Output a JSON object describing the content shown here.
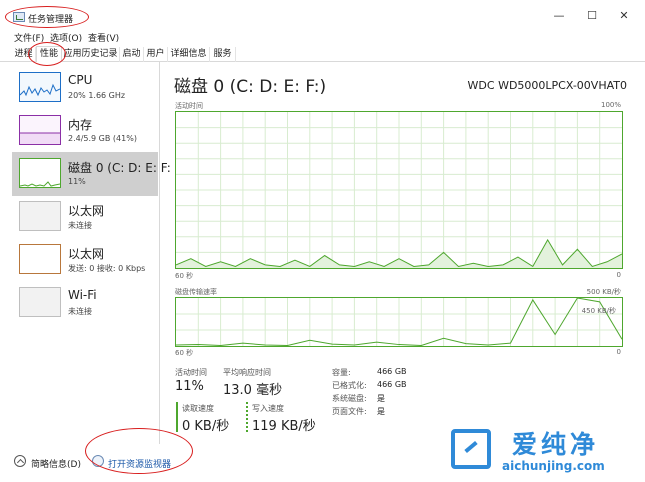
{
  "window": {
    "title": "任务管理器",
    "controls": {
      "minimize": "—",
      "maximize": "☐",
      "close": "✕"
    }
  },
  "menu": {
    "file": "文件(F)",
    "options": "选项(O)",
    "view": "查看(V)"
  },
  "tabs": [
    {
      "label": "进程"
    },
    {
      "label": "性能"
    },
    {
      "label": "应用历史记录"
    },
    {
      "label": "启动"
    },
    {
      "label": "用户"
    },
    {
      "label": "详细信息"
    },
    {
      "label": "服务"
    }
  ],
  "sidebar": {
    "items": [
      {
        "name": "CPU",
        "sub": "20% 1.66 GHz",
        "color": "#1e6fc7"
      },
      {
        "name": "内存",
        "sub": "2.4/5.9 GB (41%)",
        "color": "#8b2fa6"
      },
      {
        "name": "磁盘 0 (C: D: E: F:",
        "sub": "11%",
        "color": "#4ea72e"
      },
      {
        "name": "以太网",
        "sub": "未连接",
        "color": "#bfbfbf"
      },
      {
        "name": "以太网",
        "sub": "发送: 0 接收: 0 Kbps",
        "color": "#b8773c"
      },
      {
        "name": "Wi-Fi",
        "sub": "未连接",
        "color": "#bfbfbf"
      }
    ]
  },
  "disk": {
    "title": "磁盘 0 (C: D: E: F:)",
    "model": "WDC WD5000LPCX-00VHAT0",
    "active_time_label": "活动时间",
    "active_max": "100%",
    "active_x_left": "60 秒",
    "active_x_right": "0",
    "transfer_label": "磁盘传输速率",
    "transfer_max": "500 KB/秒",
    "transfer_mark": "450 KB/秒",
    "transfer_x_left": "60 秒",
    "transfer_x_right": "0",
    "stats": {
      "active_label": "活动时间",
      "active_value": "11%",
      "response_label": "平均响应时间",
      "response_value": "13.0 毫秒",
      "read_label": "读取速度",
      "read_value": "0 KB/秒",
      "write_label": "写入速度",
      "write_value": "119 KB/秒"
    },
    "details": [
      {
        "label": "容量:",
        "value": "466 GB"
      },
      {
        "label": "已格式化:",
        "value": "466 GB"
      },
      {
        "label": "系统磁盘:",
        "value": "是"
      },
      {
        "label": "页面文件:",
        "value": "是"
      }
    ]
  },
  "chart_data": [
    {
      "type": "area",
      "title": "活动时间",
      "x": [
        60,
        58,
        56,
        54,
        52,
        50,
        48,
        46,
        44,
        42,
        40,
        38,
        36,
        34,
        32,
        30,
        28,
        26,
        24,
        22,
        20,
        18,
        16,
        14,
        12,
        10,
        8,
        6,
        4,
        2,
        0
      ],
      "values": [
        2,
        6,
        1,
        4,
        1,
        6,
        2,
        1,
        5,
        1,
        8,
        2,
        1,
        4,
        1,
        6,
        1,
        2,
        10,
        1,
        3,
        1,
        2,
        7,
        1,
        18,
        2,
        12,
        1,
        4,
        9
      ],
      "ylim": [
        0,
        100
      ],
      "color": "#4ea72e"
    },
    {
      "type": "line",
      "title": "磁盘传输速率",
      "x": [
        60,
        57,
        54,
        51,
        48,
        45,
        42,
        39,
        36,
        33,
        30,
        27,
        24,
        21,
        18,
        15,
        12,
        9,
        6,
        3,
        0
      ],
      "values": [
        10,
        15,
        5,
        30,
        10,
        5,
        60,
        20,
        10,
        40,
        15,
        5,
        80,
        25,
        10,
        30,
        480,
        120,
        500,
        460,
        70
      ],
      "ylim": [
        0,
        500
      ],
      "color": "#4ea72e"
    }
  ],
  "footer": {
    "brief": "简略信息(D)",
    "resource_monitor": "打开资源监视器"
  },
  "watermark": {
    "title": "爱纯净",
    "url": "aichunjing.com"
  }
}
